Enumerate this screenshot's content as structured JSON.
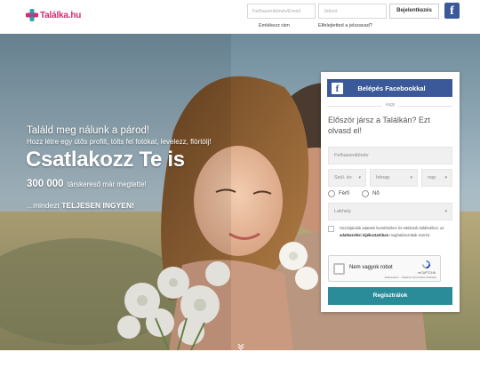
{
  "brand": {
    "name": "Találka.hu",
    "color": "#d62b6e"
  },
  "header": {
    "email_placeholder": "Felhasználónév/Email",
    "password_placeholder": "Jelszó",
    "login_label": "Bejelentkezés",
    "facebook_icon": "f",
    "remember_me": "Emlékezz rám",
    "forgot_password": "Elfelejtetted a jelszavad?"
  },
  "hero": {
    "tagline": "Találd meg nálunk a párod!",
    "sub": "Hozz létre egy ütős profilt, tölts fel fotókat, levelezz, flörtölj!",
    "headline": "Csatlakozz Te is",
    "count_number": "300 000",
    "count_text": "társkereső már megtette!",
    "free_prefix": "...mindezt",
    "free_bold": "TELJESEN INGYEN!",
    "scroll_icon": "chevron-double-down"
  },
  "form": {
    "fb_icon": "f",
    "fb_button": "Belépés Facebookkal",
    "or": "vagy",
    "title": "Először jársz a Találkán? Ezt olvasd el!",
    "username_placeholder": "Felhasználónév",
    "birth_year": "Szül. év",
    "birth_month": "hónap",
    "birth_day": "nap",
    "gender_male": "Férfi",
    "gender_female": "Nő",
    "location": "Lakhely",
    "consent_text_1": "Hozzájárulok adataim kezeléséhez és reklámok küldéséhez, az",
    "consent_bold": "adatkezelési tájékoztatóban",
    "consent_text_2": "meghatározottak szerint.",
    "captcha_label": "Nem vagyok robot",
    "captcha_brand": "reCAPTCHA",
    "captcha_terms": "Adatvédelem – Általános Szerződési Feltételek",
    "register_button": "Regisztrálok",
    "accent_color": "#2a8c99",
    "facebook_color": "#3b5998"
  }
}
